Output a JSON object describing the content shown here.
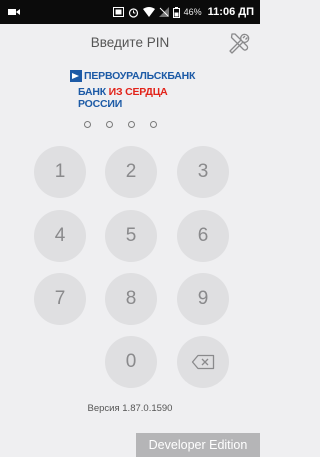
{
  "status_bar": {
    "icons": [
      "video-icon",
      "screenshot-icon",
      "alarm-icon",
      "wifi-icon",
      "signal-icon",
      "battery-icon"
    ],
    "battery_percent": "46%",
    "time": "11:06 ДП"
  },
  "header": {
    "title": "Введите PIN",
    "settings_icon": "tools-icon"
  },
  "logo": {
    "line1": "ПЕРВОУРАЛЬСКБАНК",
    "line2_part1": "БАНК ",
    "line2_part2": "ИЗ СЕРДЦА",
    "line2_part3": " РОССИИ",
    "colors": {
      "blue": "#1c5aa6",
      "red": "#e2231a"
    }
  },
  "pin": {
    "length": 4,
    "entered": 0
  },
  "keypad": {
    "keys": [
      "1",
      "2",
      "3",
      "4",
      "5",
      "6",
      "7",
      "8",
      "9",
      "0"
    ],
    "backspace_icon": "backspace-icon"
  },
  "version_text": "Версия 1.87.0.1590",
  "developer_badge": "Developer Edition"
}
